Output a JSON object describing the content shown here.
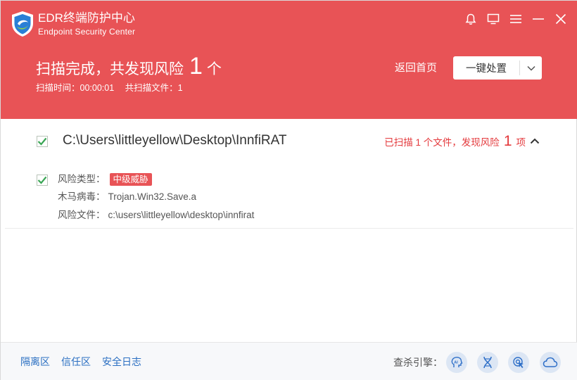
{
  "app": {
    "title": "EDR终端防护中心",
    "subtitle": "Endpoint Security Center"
  },
  "window_controls": [
    "bell-icon",
    "monitor-icon",
    "menu-icon",
    "minimize-icon",
    "close-icon"
  ],
  "scan": {
    "headline": "扫描完成，共发现风险",
    "risk_count": "1",
    "unit": "个",
    "time": "扫描时间：00:00:01",
    "files": "共扫描文件：1"
  },
  "actions": {
    "back_home": "返回首页",
    "one_click": "一键处置"
  },
  "result": {
    "path": "C:\\Users\\littleyellow\\Desktop\\InnfiRAT",
    "summary_prefix": "已扫描 1 个文件，发现风险",
    "summary_count": "1",
    "summary_suffix": "项",
    "risk_type_label": "风险类型：",
    "risk_level": "中级威胁",
    "virus_label": "木马病毒：",
    "virus_name": "Trojan.Win32.Save.a",
    "file_label": "风险文件：",
    "file_path": "c:\\users\\littleyellow\\desktop\\innfirat"
  },
  "footer": {
    "links": [
      "隔离区",
      "信任区",
      "安全日志"
    ],
    "engines_label": "查杀引擎：",
    "engines": [
      "ai-engine-icon",
      "dna-engine-icon",
      "behavior-engine-icon",
      "cloud-engine-icon"
    ]
  },
  "colors": {
    "header_bg": "#e85356",
    "risk_red": "#e4393c",
    "link_blue": "#2b6fc2",
    "check_green": "#3aa655"
  }
}
